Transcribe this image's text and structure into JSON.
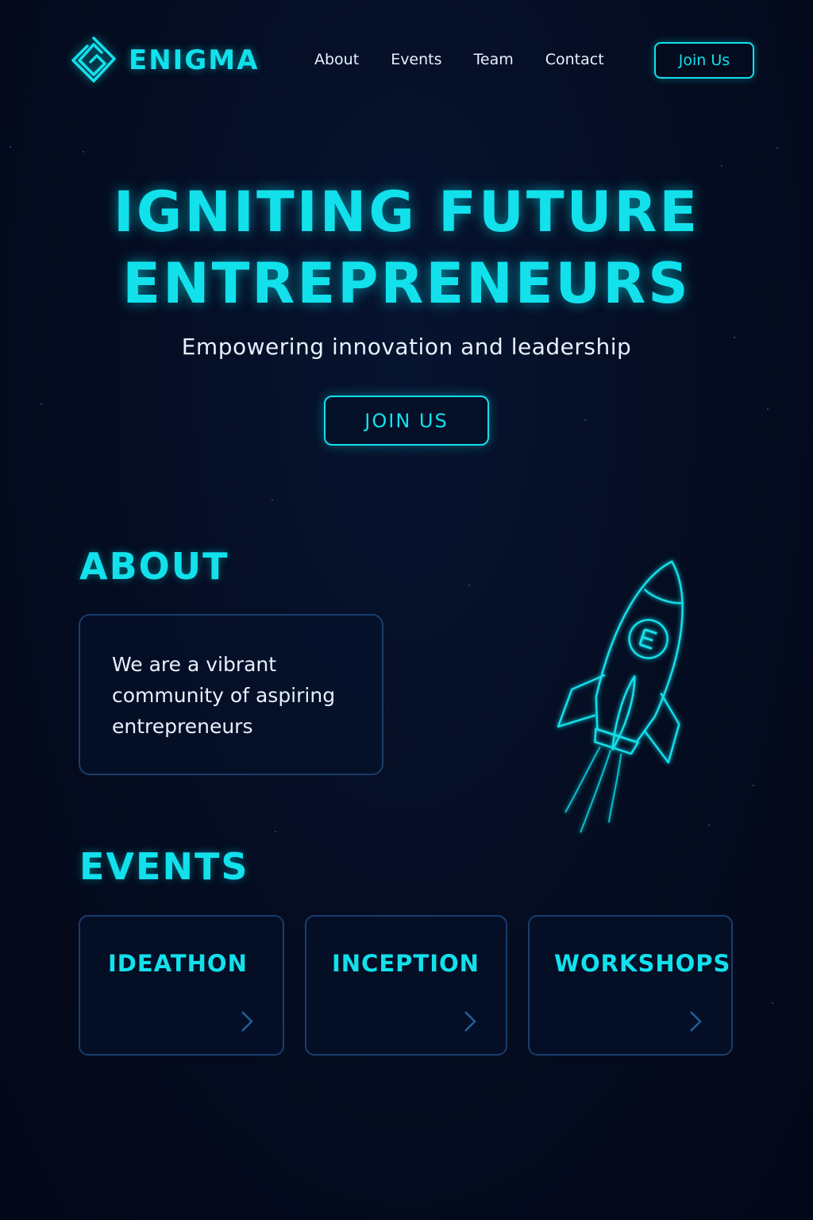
{
  "brand": {
    "name": "ENIGMA",
    "logo_icon": "enigma-logo-icon"
  },
  "nav": {
    "links": [
      "About",
      "Events",
      "Team",
      "Contact"
    ],
    "cta_label": "Join Us"
  },
  "hero": {
    "title_line1": "IGNITING FUTURE",
    "title_line2": "ENTREPRENEURS",
    "subtitle": "Empowering innovation and leadership",
    "cta_label": "JOIN US"
  },
  "about": {
    "heading": "ABOUT",
    "text": "We are a vibrant community of aspiring entrepreneurs",
    "illustration": "rocket-icon"
  },
  "events": {
    "heading": "EVENTS",
    "items": [
      {
        "label": "IDEATHON",
        "icon": "chevron-right-icon"
      },
      {
        "label": "INCEPTION",
        "icon": "chevron-right-icon"
      },
      {
        "label": "WORKSHOPS",
        "icon": "chevron-right-icon"
      }
    ]
  },
  "colors": {
    "accent": "#12e1ec",
    "background": "#040c20",
    "card_border": "#1a3d6b",
    "text": "#e7f0fb"
  }
}
